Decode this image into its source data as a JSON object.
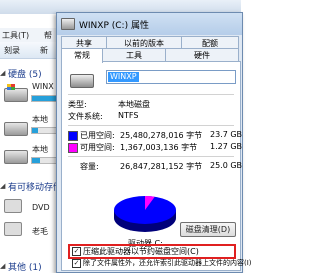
{
  "explorer": {
    "menu": [
      "工具(T)",
      "帮"
    ],
    "toolbar": [
      "刻录",
      "新"
    ],
    "sections": {
      "hard_disk": "硬盘 (5)",
      "removable": "有可移动存储",
      "other": "其他 (1)"
    },
    "drives": [
      {
        "name": "WINX",
        "used_fraction": 0.6
      },
      {
        "name": "本地",
        "used_fraction": 0.15
      },
      {
        "name": "本地",
        "used_fraction": 0.2
      }
    ],
    "devices": [
      "DVD",
      "老毛"
    ]
  },
  "dialog": {
    "title": "WINXP (C:) 属性",
    "tabs_back": [
      "共享",
      "以前的版本",
      "配额"
    ],
    "tabs_front": [
      "常规",
      "工具",
      "硬件"
    ],
    "active_tab": "常规",
    "volume_name": "WINXP",
    "type_label": "类型:",
    "type_value": "本地磁盘",
    "fs_label": "文件系统:",
    "fs_value": "NTFS",
    "used_label": "已用空间:",
    "used_bytes": "25,480,278,016 字节",
    "used_gb": "23.7 GB",
    "free_label": "可用空间:",
    "free_bytes": "1,367,003,136 字节",
    "free_gb": "1.27 GB",
    "capacity_label": "容量:",
    "capacity_bytes": "26,847,281,152 字节",
    "capacity_gb": "25.0 GB",
    "drive_label": "驱动器 C:",
    "cleanup_button": "磁盘清理(D)",
    "compress_label": "压缩此驱动器以节约磁盘空间(C)",
    "compress_checked": true,
    "index_label": "除了文件属性外，还允许索引此驱动器上文件的内容(I)",
    "index_checked": true,
    "used_color": "#0000ff",
    "free_color": "#ff00ff",
    "used_fraction": 0.949
  }
}
